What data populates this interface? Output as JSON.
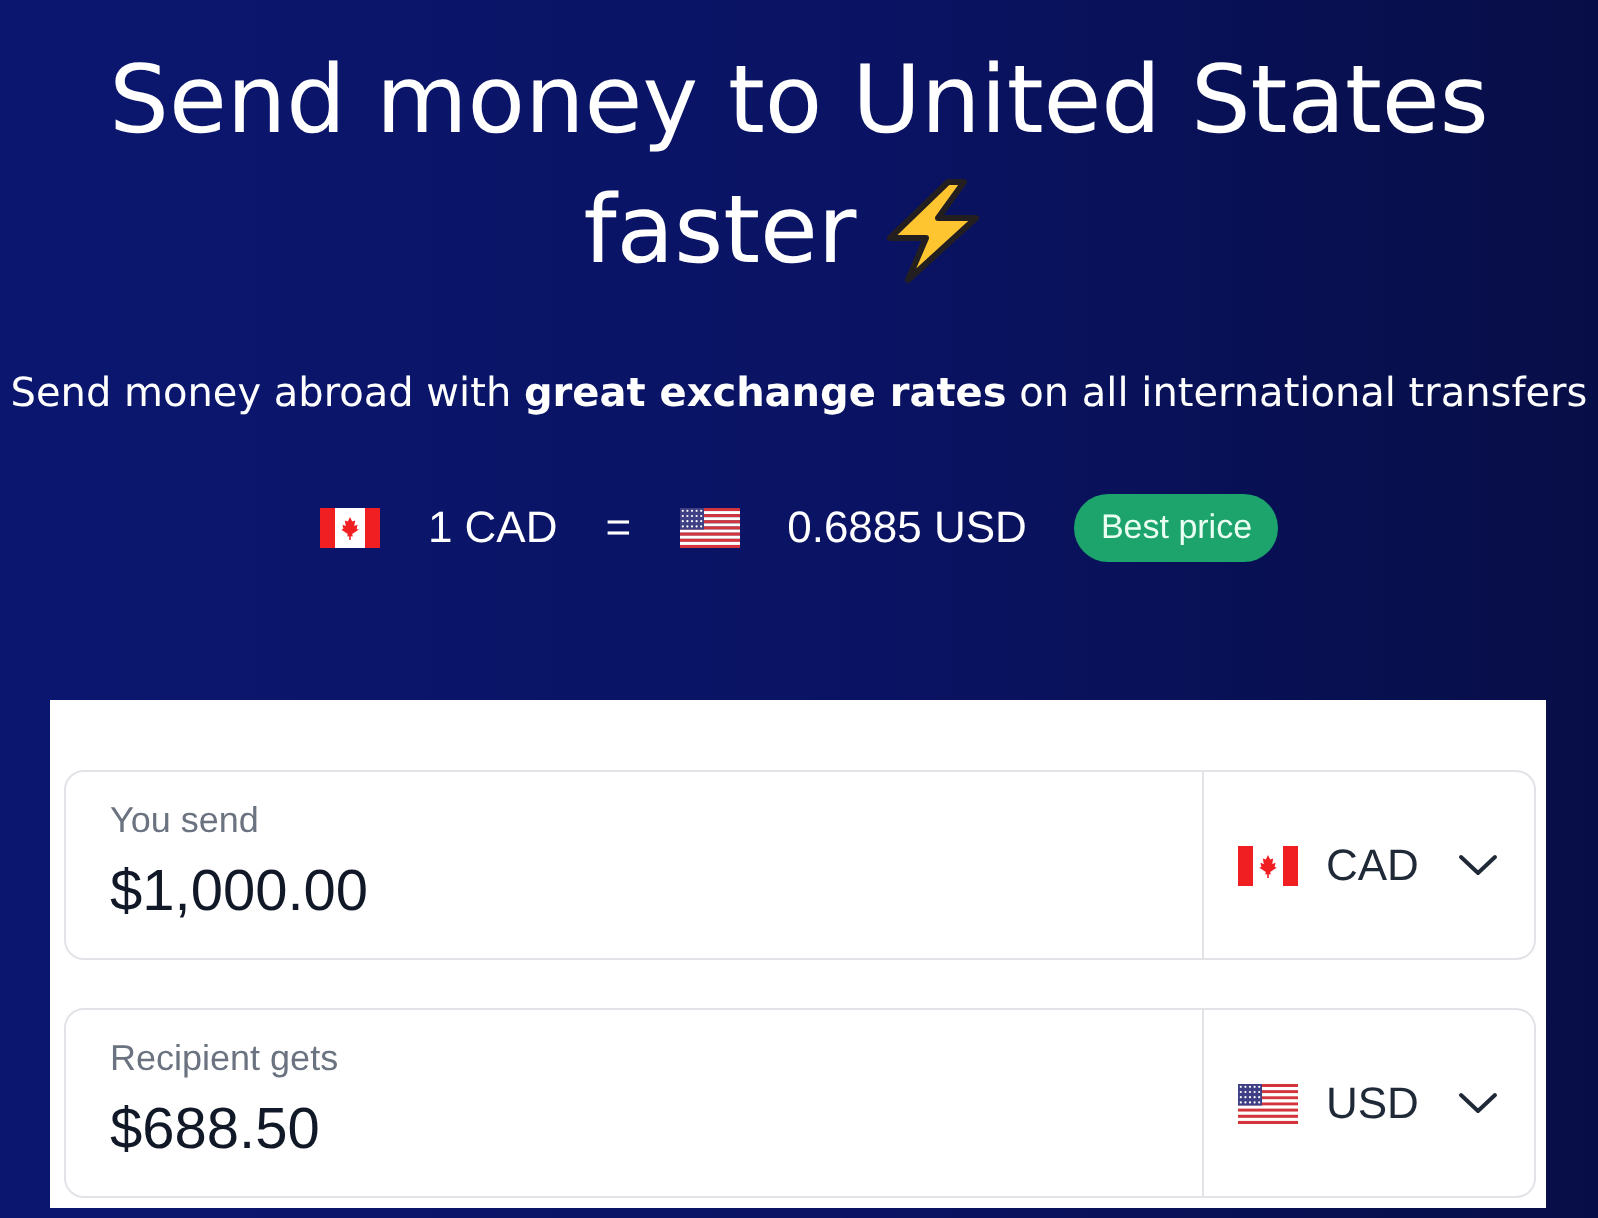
{
  "hero": {
    "title_lines": [
      "Send money to United States",
      "faster"
    ],
    "subtitle": "Send money abroad with **great exchange rates** on all international transfers"
  },
  "rate": {
    "from": {
      "kind": "canada",
      "amount": "1 CAD"
    },
    "separator": "=",
    "to": {
      "kind": "usa",
      "amount": "0.6885 USD"
    },
    "badge": "Best price"
  },
  "converter": {
    "fields": [
      {
        "label": "You send",
        "value": "$1,000.00",
        "currency": {
          "kind": "canada",
          "code": "CAD"
        }
      },
      {
        "label": "Recipient gets",
        "value": "$688.50",
        "currency": {
          "kind": "usa",
          "code": "USD"
        }
      }
    ]
  }
}
